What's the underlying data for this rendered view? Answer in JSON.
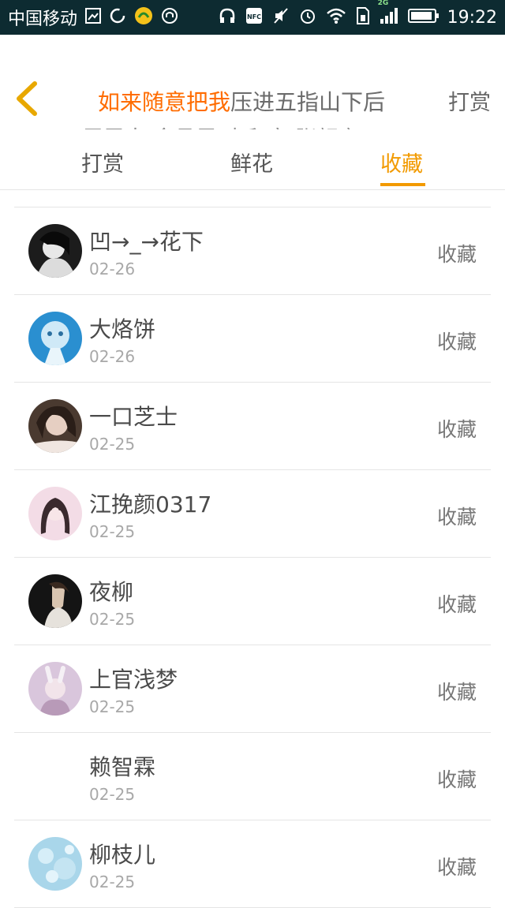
{
  "status_bar": {
    "carrier": "中国移动",
    "network": "2G",
    "time": "19:22"
  },
  "header": {
    "title_highlight": "如来随意把我",
    "title_rest": "压进五指山下后",
    "subtitle": "周震南/余承恩/李和宸/张颜齐:",
    "right_action": "打赏"
  },
  "tabs": [
    {
      "label": "打赏"
    },
    {
      "label": "鲜花"
    },
    {
      "label": "收藏"
    }
  ],
  "active_tab": "收藏",
  "accent_color": "#f29a00",
  "list": [
    {
      "name": "凹→_→花下",
      "date": "02-26",
      "action": "收藏"
    },
    {
      "name": "大烙饼",
      "date": "02-26",
      "action": "收藏"
    },
    {
      "name": "一口芝士",
      "date": "02-25",
      "action": "收藏"
    },
    {
      "name": "江挽颜0317",
      "date": "02-25",
      "action": "收藏"
    },
    {
      "name": "夜柳",
      "date": "02-25",
      "action": "收藏"
    },
    {
      "name": "上官浅梦",
      "date": "02-25",
      "action": "收藏"
    },
    {
      "name": "赖智霖",
      "date": "02-25",
      "action": "收藏"
    },
    {
      "name": "柳枝儿",
      "date": "02-25",
      "action": "收藏"
    }
  ]
}
